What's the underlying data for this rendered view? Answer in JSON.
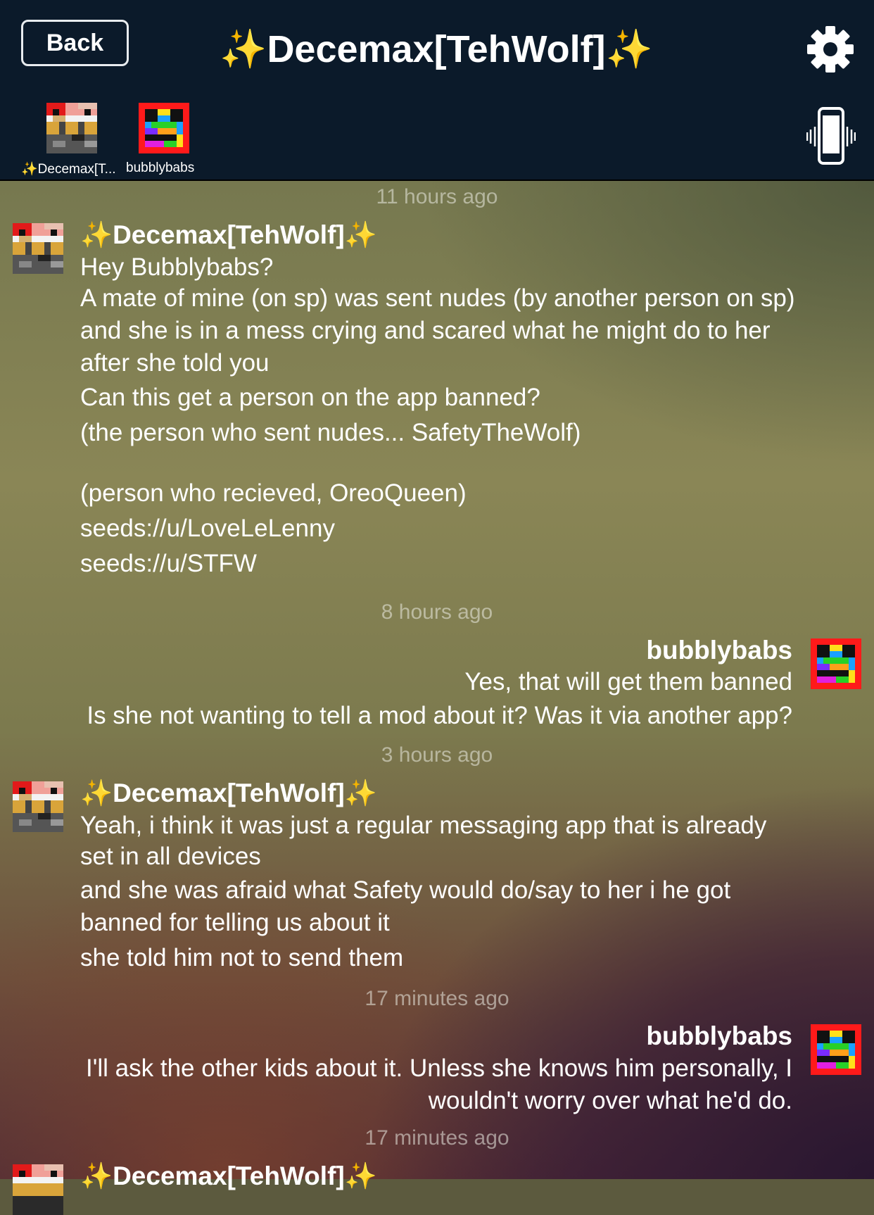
{
  "header": {
    "back_label": "Back",
    "title": "✨Decemax[TehWolf]✨",
    "participants": [
      {
        "name": "✨Decemax[T..."
      },
      {
        "name": "bubblybabs"
      }
    ]
  },
  "conversation": [
    {
      "type": "timestamp",
      "text": "11 hours ago"
    },
    {
      "type": "message",
      "sender": "✨Decemax[TehWolf]✨",
      "lines": [
        "Hey Bubblybabs?",
        "A mate of mine (on sp) was sent nudes (by another person on sp)",
        "and she is in a mess crying and scared what he might do to her",
        "after she told you",
        "Can this get a person on the app banned?",
        "(the person who sent nudes... SafetyTheWolf)",
        "",
        "(person who recieved, OreoQueen)",
        "seeds://u/LoveLeLenny",
        "seeds://u/STFW"
      ]
    },
    {
      "type": "timestamp",
      "text": "8 hours ago"
    },
    {
      "type": "message",
      "sender": "bubblybabs",
      "lines": [
        "Yes, that will get them banned",
        "Is she not wanting to tell a mod about it?  Was it via another app?"
      ]
    },
    {
      "type": "timestamp",
      "text": "3 hours ago"
    },
    {
      "type": "message",
      "sender": "✨Decemax[TehWolf]✨",
      "lines": [
        "Yeah, i think it was just a regular messaging app that is already",
        "set in all devices",
        "and she was afraid what Safety would do/say to her i he got",
        "banned for telling us about it",
        "she told him not to send them"
      ]
    },
    {
      "type": "timestamp",
      "text": "17 minutes ago"
    },
    {
      "type": "message",
      "sender": "bubblybabs",
      "lines": [
        "I'll ask the other kids about it.  Unless she knows him personally, I",
        "wouldn't worry over what he'd do."
      ]
    },
    {
      "type": "timestamp",
      "text": "17 minutes ago"
    },
    {
      "type": "message",
      "sender": "✨Decemax[TehWolf]✨",
      "lines": []
    }
  ],
  "icons": {
    "settings": "gear-icon",
    "vibrate": "vibrate-phone-icon",
    "avatar_decemax": "pixel-wolf-avatar",
    "avatar_bubblybabs": "pixel-rainbow-avatar"
  }
}
